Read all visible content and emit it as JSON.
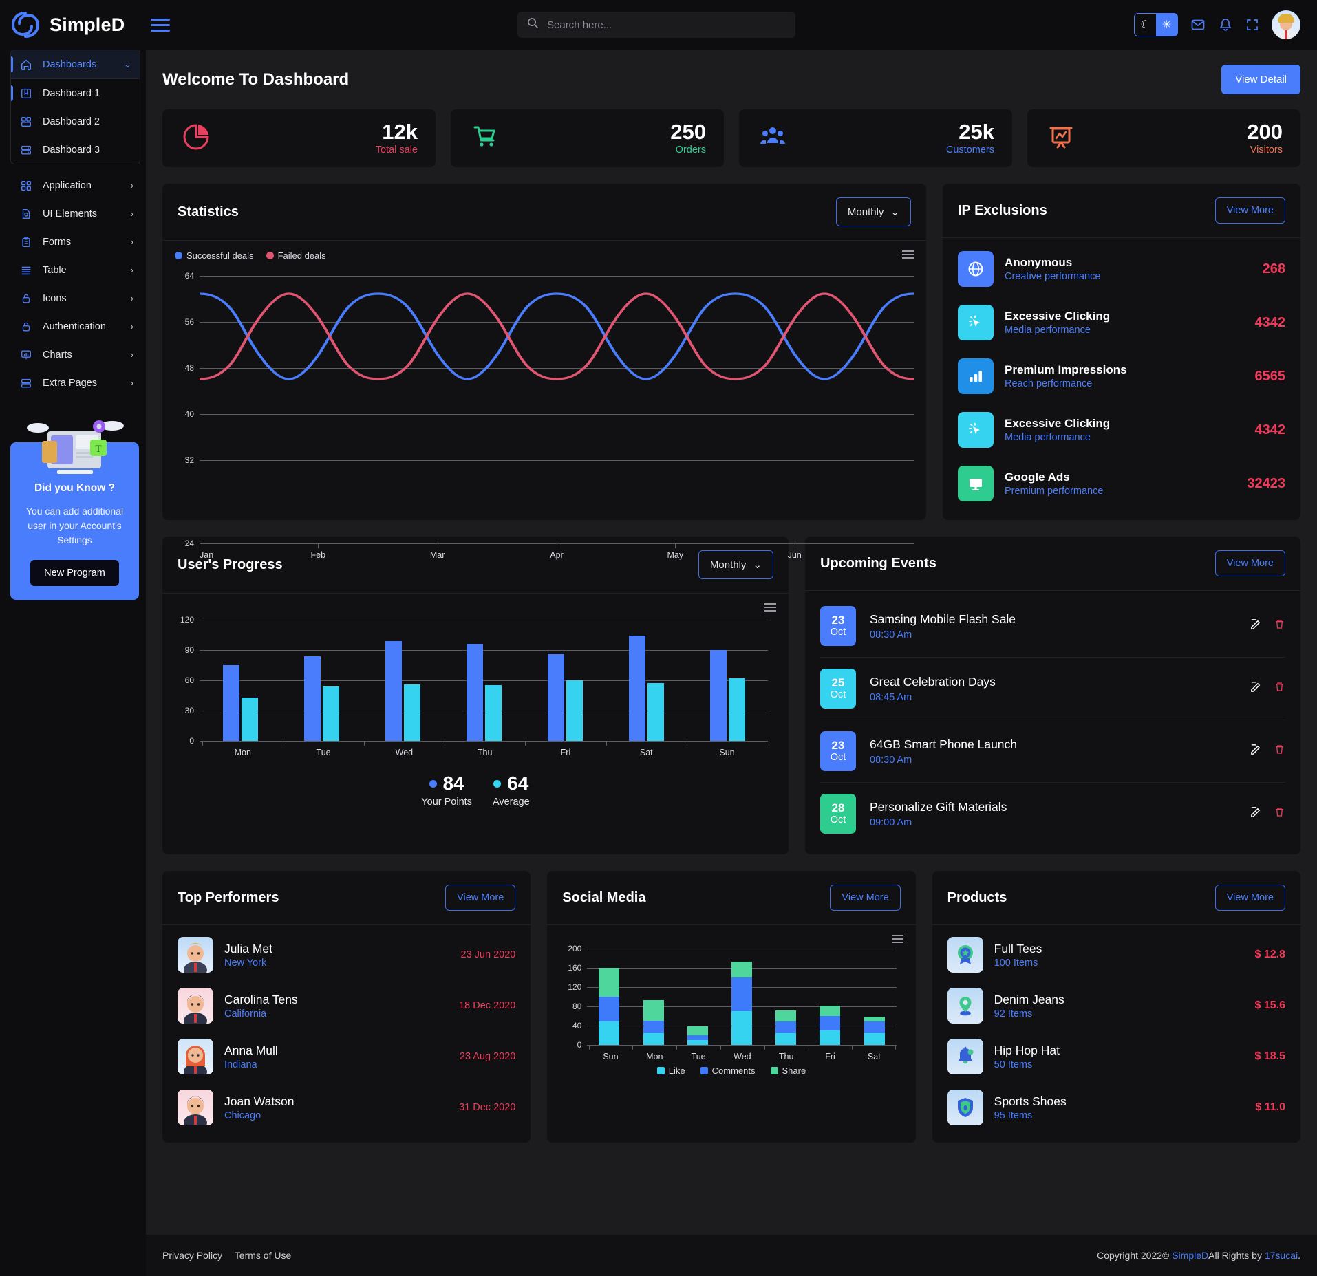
{
  "brand": {
    "name": "SimpleD",
    "logo_icon": "infinity-s-logo",
    "menu_icon": "hamburger-menu-icon"
  },
  "search": {
    "placeholder": "Search here...",
    "value": "",
    "icon": "search-icon"
  },
  "topbar": {
    "theme_moon_icon": "moon-icon",
    "theme_sun_icon": "sun-icon",
    "mail_icon": "envelope-icon",
    "bell_icon": "bell-icon",
    "fullscreen_icon": "fullscreen-icon",
    "avatar": "user-avatar"
  },
  "sidebar": {
    "group": {
      "label": "Dashboards",
      "icon": "home-icon",
      "chevron": "chevron-down-icon",
      "children": [
        {
          "label": "Dashboard 1",
          "icon": "bookmark-icon",
          "selected": true
        },
        {
          "label": "Dashboard 2",
          "icon": "layout-icon",
          "selected": false
        },
        {
          "label": "Dashboard 3",
          "icon": "server-icon",
          "selected": false
        }
      ]
    },
    "items": [
      {
        "label": "Application",
        "icon": "grid-icon"
      },
      {
        "label": "UI Elements",
        "icon": "palette-icon"
      },
      {
        "label": "Forms",
        "icon": "clipboard-icon"
      },
      {
        "label": "Table",
        "icon": "list-icon"
      },
      {
        "label": "Icons",
        "icon": "lock-icon"
      },
      {
        "label": "Authentication",
        "icon": "lock-icon"
      },
      {
        "label": "Charts",
        "icon": "presentation-chart-icon"
      },
      {
        "label": "Extra Pages",
        "icon": "server-icon"
      }
    ],
    "promo": {
      "title": "Did you Know ?",
      "text": "You can add additional user in your Account's Settings",
      "button": "New Program"
    }
  },
  "welcome": {
    "title": "Welcome To Dashboard",
    "button": "View Detail"
  },
  "stats": [
    {
      "value": "12k",
      "label": "Total sale",
      "icon": "pie-chart-icon",
      "color": "#e8405e"
    },
    {
      "value": "250",
      "label": "Orders",
      "icon": "shopping-cart-icon",
      "color": "#2ecc8f"
    },
    {
      "value": "25k",
      "label": "Customers",
      "icon": "users-icon",
      "color": "#4a7dfc"
    },
    {
      "value": "200",
      "label": "Visitors",
      "icon": "presentation-chart-icon",
      "color": "#f0714b"
    }
  ],
  "statistics": {
    "title": "Statistics",
    "period": "Monthly",
    "period_chevron": "chevron-down-icon",
    "menu_icon": "hamburger-menu-icon"
  },
  "ip_exclusions": {
    "title": "IP Exclusions",
    "view_more": "View More",
    "rows": [
      {
        "name": "Anonymous",
        "sub": "Creative performance",
        "value": "268",
        "icon": "globe-icon",
        "bg": "#4a7dfc"
      },
      {
        "name": "Excessive Clicking",
        "sub": "Media performance",
        "value": "4342",
        "icon": "cursor-click-icon",
        "bg": "#35d3ef"
      },
      {
        "name": "Premium Impressions",
        "sub": "Reach performance",
        "value": "6565",
        "icon": "bar-chart-icon",
        "bg": "#1f8fe8"
      },
      {
        "name": "Excessive Clicking",
        "sub": "Media performance",
        "value": "4342",
        "icon": "cursor-click-icon",
        "bg": "#35d3ef"
      },
      {
        "name": "Google Ads",
        "sub": "Premium performance",
        "value": "32423",
        "icon": "monitor-icon",
        "bg": "#2ecc8f"
      }
    ]
  },
  "users_progress": {
    "title": "User's Progress",
    "period": "Monthly",
    "period_chevron": "chevron-down-icon",
    "menu_icon": "hamburger-menu-icon",
    "summary": [
      {
        "value": "84",
        "label": "Your Points",
        "color": "#4a7dfc"
      },
      {
        "value": "64",
        "label": "Average",
        "color": "#35d3ef"
      }
    ]
  },
  "upcoming_events": {
    "title": "Upcoming Events",
    "view_more": "View More",
    "edit_icon": "edit-icon",
    "delete_icon": "trash-icon",
    "rows": [
      {
        "day": "23",
        "month": "Oct",
        "title": "Samsing Mobile Flash Sale",
        "time": "08:30 Am",
        "bg": "#4a7dfc"
      },
      {
        "day": "25",
        "month": "Oct",
        "title": "Great Celebration Days",
        "time": "08:45 Am",
        "bg": "#35d3ef"
      },
      {
        "day": "23",
        "month": "Oct",
        "title": "64GB Smart Phone Launch",
        "time": "08:30 Am",
        "bg": "#4a7dfc"
      },
      {
        "day": "28",
        "month": "Oct",
        "title": "Personalize Gift Materials",
        "time": "09:00 Am",
        "bg": "#2ecc8f"
      }
    ]
  },
  "top_performers": {
    "title": "Top Performers",
    "view_more": "View More",
    "rows": [
      {
        "name": "Julia Met",
        "city": "New York",
        "date": "23 Jun 2020",
        "hair": "#e0b03a",
        "bg": "#bcd9f5"
      },
      {
        "name": "Carolina Tens",
        "city": "California",
        "date": "18 Dec 2020",
        "hair": "#20202a",
        "bg": "#f8d7de"
      },
      {
        "name": "Anna Mull",
        "city": "Indiana",
        "date": "23 Aug 2020",
        "hair": "#e2603a",
        "bg": "#cfe4f7"
      },
      {
        "name": "Joan Watson",
        "city": "Chicago",
        "date": "31 Dec 2020",
        "hair": "#20202a",
        "bg": "#f8d7de"
      }
    ]
  },
  "social_media": {
    "title": "Social Media",
    "view_more": "View More",
    "menu_icon": "hamburger-menu-icon"
  },
  "products": {
    "title": "Products",
    "view_more": "View More",
    "rows": [
      {
        "name": "Full Tees",
        "items": "100 Items",
        "price": "$ 12.8",
        "icon": "badge-icon"
      },
      {
        "name": "Denim Jeans",
        "items": "92 Items",
        "price": "$ 15.6",
        "icon": "map-pin-icon"
      },
      {
        "name": "Hip Hop Hat",
        "items": "50 Items",
        "price": "$ 18.5",
        "icon": "bell-icon"
      },
      {
        "name": "Sports Shoes",
        "items": "95 Items",
        "price": "$ 11.0",
        "icon": "shield-lock-icon"
      }
    ]
  },
  "footer": {
    "privacy": "Privacy Policy",
    "terms": "Terms of Use",
    "copyright_pre": "Copyright 2022© ",
    "brand": "SimpleD",
    "copyright_mid": "All Rights by ",
    "credit": "17sucai",
    "copyright_end": "."
  },
  "chart_data": [
    {
      "type": "line",
      "id": "statistics",
      "title": "Statistics",
      "xlabel": "",
      "ylabel": "",
      "x": [
        "Jan",
        "Feb",
        "Mar",
        "Apr",
        "May",
        "Jun"
      ],
      "ylim": [
        24,
        64
      ],
      "yticks": [
        24,
        32,
        40,
        48,
        56,
        64
      ],
      "grid": true,
      "legend": "top-left",
      "series": [
        {
          "name": "Successful deals",
          "color": "#4a7dfc",
          "waveform": "cosine",
          "amplitude": 15,
          "midline": 45,
          "period_months": 1.0,
          "phase": 0
        },
        {
          "name": "Failed deals",
          "color": "#e05571",
          "waveform": "cosine",
          "amplitude": 15,
          "midline": 45,
          "period_months": 1.0,
          "phase": 180
        }
      ]
    },
    {
      "type": "bar",
      "id": "users_progress",
      "title": "User's Progress",
      "categories": [
        "Mon",
        "Tue",
        "Wed",
        "Thu",
        "Fri",
        "Sat",
        "Sun"
      ],
      "ylim": [
        0,
        120
      ],
      "yticks": [
        0,
        30,
        60,
        90,
        120
      ],
      "grid": true,
      "series": [
        {
          "name": "Your Points",
          "color": "#4a7dfc",
          "values": [
            75,
            84,
            99,
            96,
            86,
            104,
            90
          ]
        },
        {
          "name": "Average",
          "color": "#35d3ef",
          "values": [
            43,
            54,
            56,
            55,
            60,
            57,
            62
          ]
        }
      ]
    },
    {
      "type": "bar",
      "id": "social_media",
      "title": "Social Media",
      "stacked": true,
      "categories": [
        "Sun",
        "Mon",
        "Tue",
        "Wed",
        "Thu",
        "Fri",
        "Sat"
      ],
      "ylim": [
        0,
        200
      ],
      "yticks": [
        0,
        40,
        80,
        120,
        160,
        200
      ],
      "grid": true,
      "legend": "bottom",
      "series": [
        {
          "name": "Like",
          "color": "#35d3ef",
          "values": [
            48,
            25,
            10,
            70,
            25,
            30,
            24
          ]
        },
        {
          "name": "Comments",
          "color": "#3d7bfa",
          "values": [
            52,
            25,
            10,
            70,
            24,
            30,
            25
          ]
        },
        {
          "name": "Share",
          "color": "#4fd69c",
          "values": [
            60,
            43,
            19,
            33,
            22,
            21,
            10
          ]
        }
      ]
    }
  ]
}
